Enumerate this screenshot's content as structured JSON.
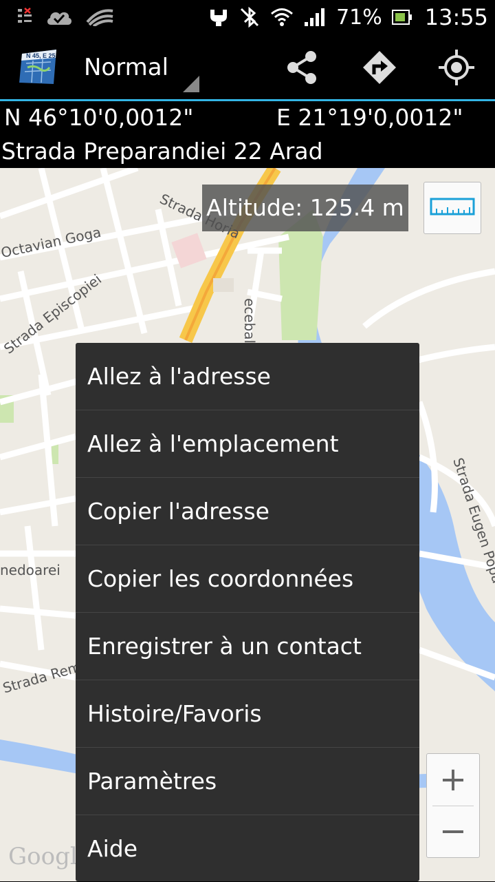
{
  "status_bar": {
    "icons": [
      "notification-icon",
      "cloud-done-icon",
      "swype-icon",
      "usb-debug-icon",
      "bluetooth-off-icon",
      "wifi-icon",
      "signal-icon",
      "battery-icon"
    ],
    "battery_percent": "71%",
    "time": "13:55"
  },
  "action_bar": {
    "app_icon_text": "N 45, E 25",
    "mode": "Normal",
    "actions": [
      "share-icon",
      "directions-icon",
      "my-location-icon"
    ],
    "accent_color": "#33b5e5"
  },
  "location": {
    "latitude": "N 46°10'0,0012\"",
    "longitude": "E 21°19'0,0012\"",
    "address": "Strada Preparandiei 22 Arad"
  },
  "map": {
    "altitude": "Altitude:  125.4 m",
    "street_labels": [
      "Strada Horia",
      "Octavian Goga",
      "Strada Episcopiei",
      "ecebal",
      "Strada Eugen Popa",
      "nedoarei",
      "Strada Remu"
    ],
    "zoom_in": "+",
    "zoom_out": "−",
    "logo": "Google"
  },
  "menu": {
    "items": [
      "Allez à l'adresse",
      "Allez à l'emplacement",
      "Copier l'adresse",
      "Copier les coordonnées",
      "Enregistrer à un contact",
      "Histoire/Favoris",
      "Paramètres",
      "Aide"
    ]
  }
}
